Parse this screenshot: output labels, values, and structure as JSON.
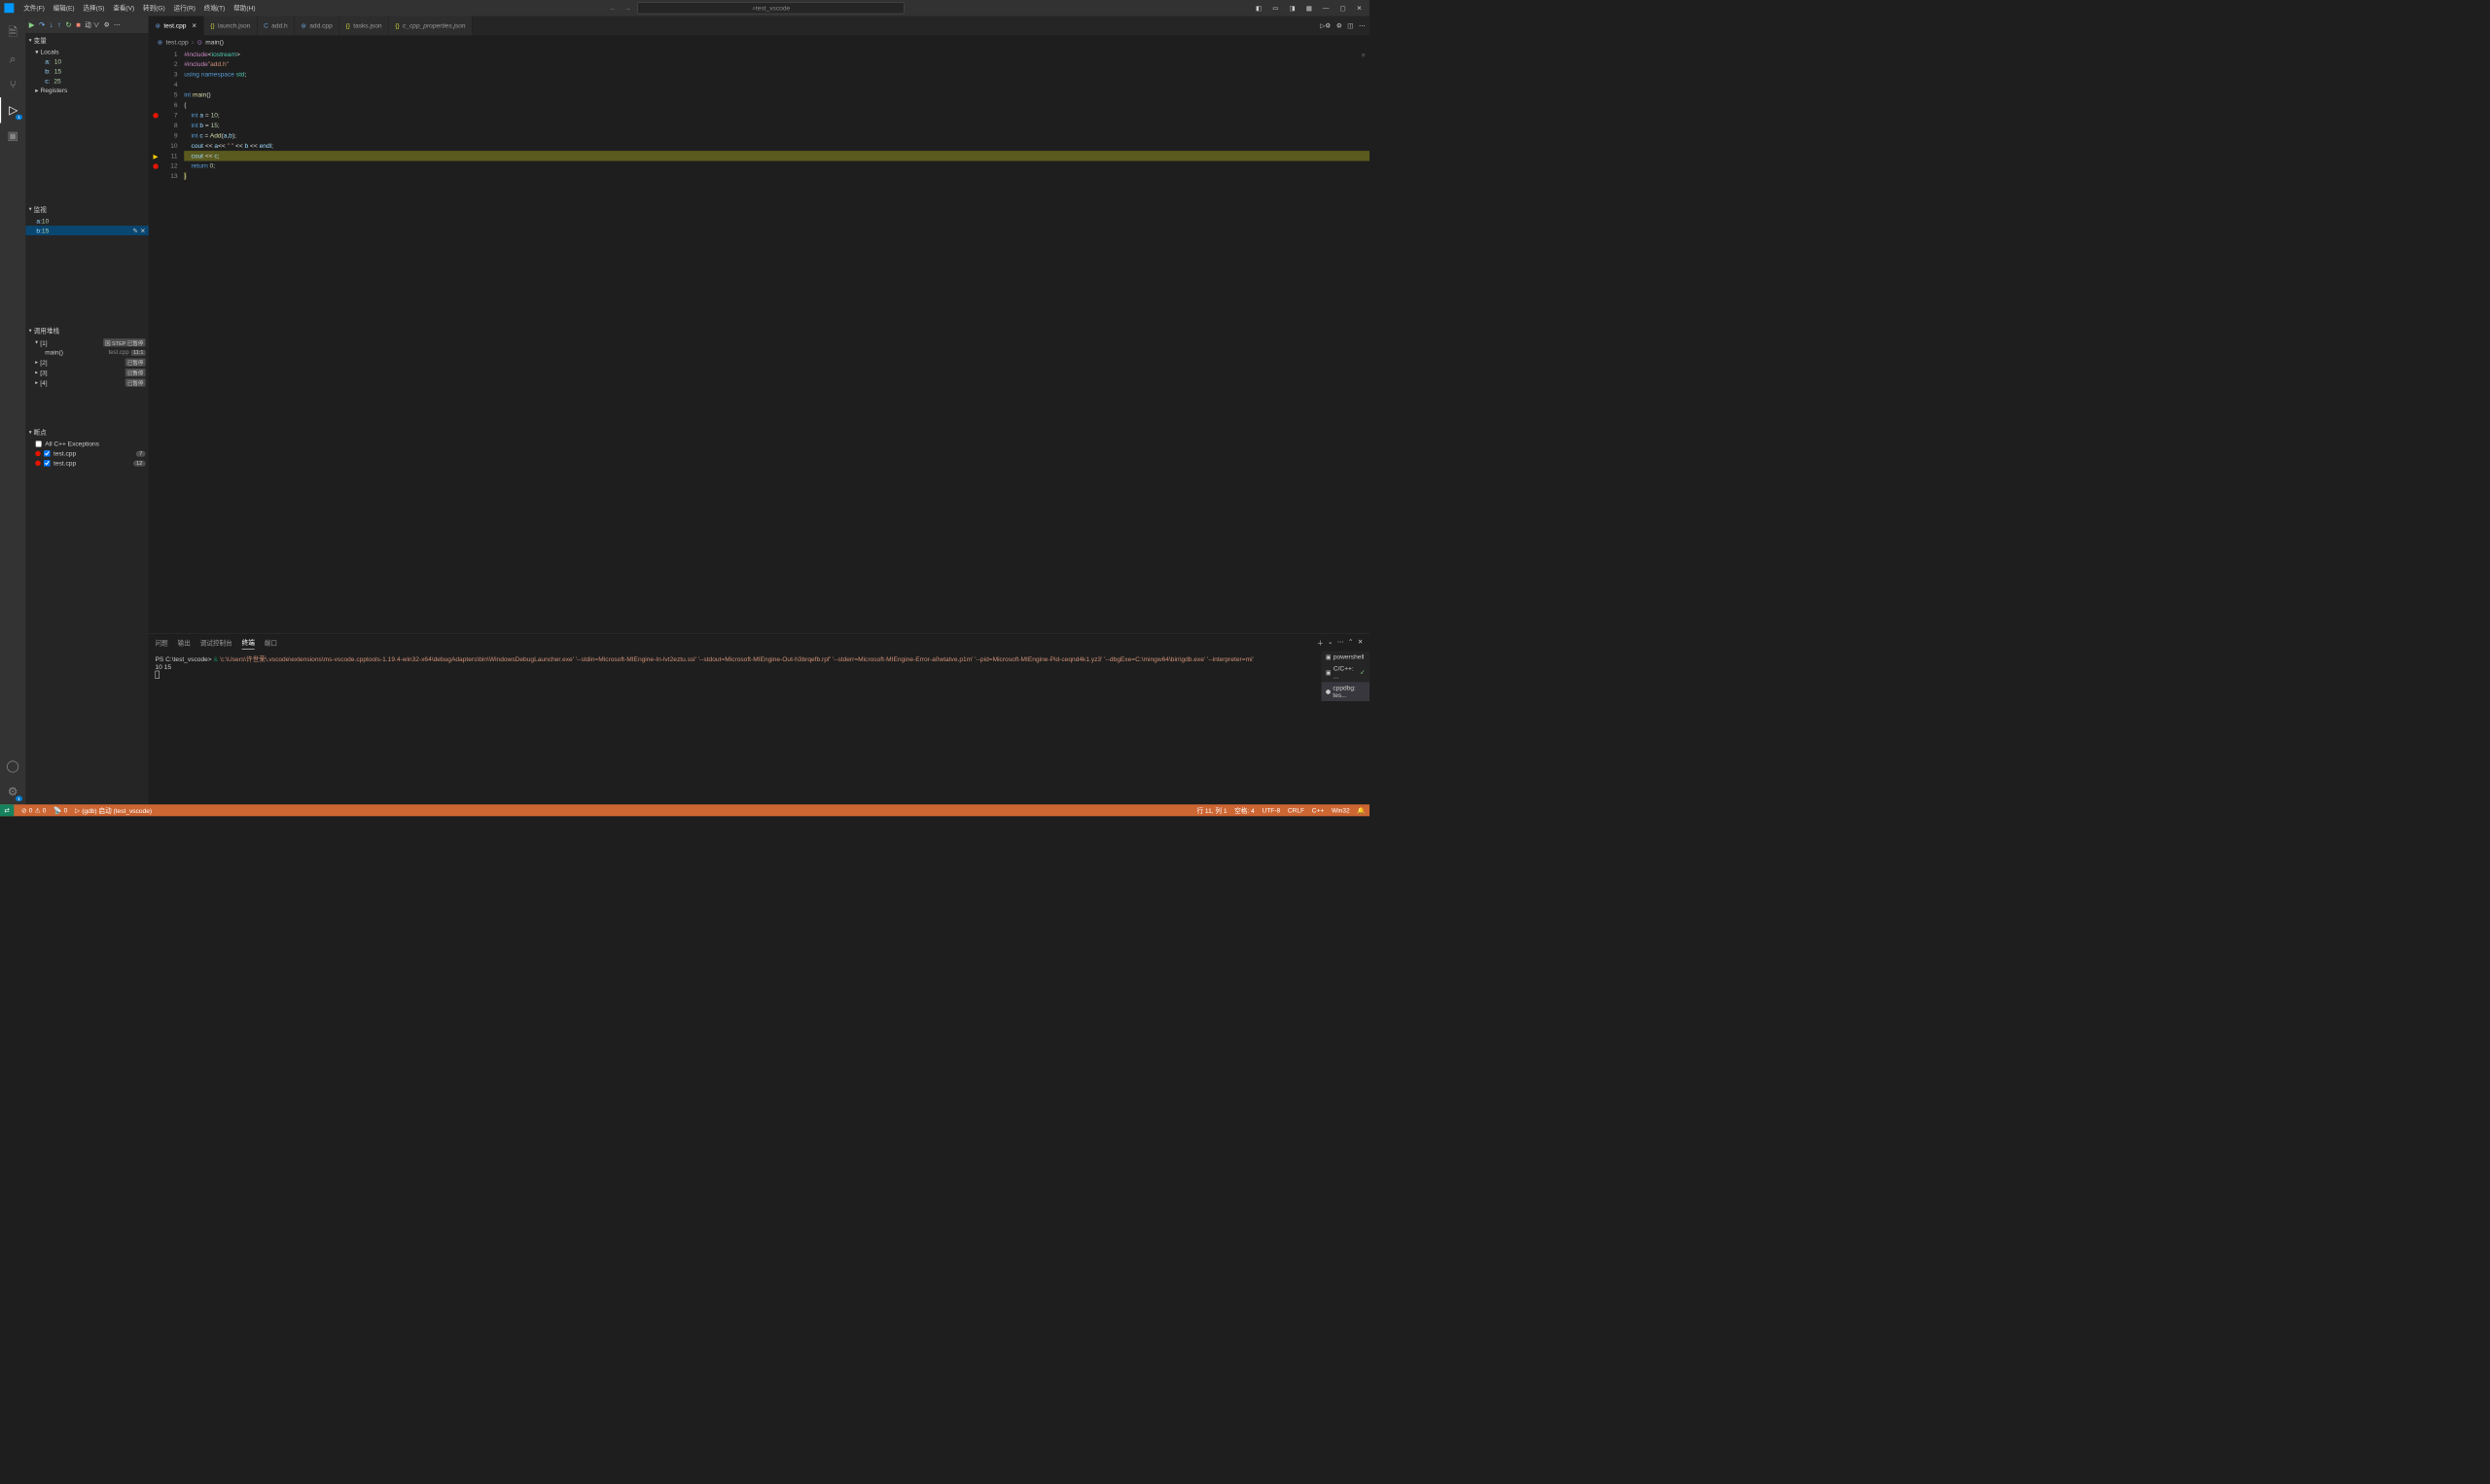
{
  "menu": [
    "文件(F)",
    "编辑(E)",
    "选择(S)",
    "查看(V)",
    "转到(G)",
    "运行(R)",
    "终端(T)",
    "帮助(H)"
  ],
  "search_placeholder": "test_vscode",
  "debug_config": "动 ∨",
  "sidebar": {
    "variables_title": "变量",
    "locals": "Locals",
    "vars": [
      {
        "name": "a:",
        "value": "10"
      },
      {
        "name": "b:",
        "value": "15"
      },
      {
        "name": "c:",
        "value": "25"
      }
    ],
    "registers": "Registers",
    "watch_title": "监视",
    "watch": [
      {
        "name": "a:",
        "value": "10"
      },
      {
        "name": "b:",
        "value": "15"
      }
    ],
    "callstack_title": "调用堆栈",
    "threads": [
      {
        "name": "[1]",
        "status": "因 STEP 已暂停",
        "frame": {
          "fn": "main()",
          "file": "test.cpp",
          "line": "11:1"
        }
      },
      {
        "name": "[2]",
        "status": "已暂停"
      },
      {
        "name": "[3]",
        "status": "已暂停"
      },
      {
        "name": "[4]",
        "status": "已暂停"
      }
    ],
    "breakpoints_title": "断点",
    "bp_exceptions": "All C++ Exceptions",
    "bp_items": [
      {
        "name": "test.cpp",
        "count": "7"
      },
      {
        "name": "test.cpp",
        "count": "12"
      }
    ]
  },
  "tabs": [
    {
      "name": "test.cpp",
      "icon": "cpp",
      "active": true,
      "close": true
    },
    {
      "name": "launch.json",
      "icon": "json"
    },
    {
      "name": "add.h",
      "icon": "cpp"
    },
    {
      "name": "add.cpp",
      "icon": "cpp"
    },
    {
      "name": "tasks.json",
      "icon": "json"
    },
    {
      "name": "c_cpp_properties.json",
      "icon": "json",
      "italic": true
    }
  ],
  "breadcrumb": {
    "file": "test.cpp",
    "symbol": "main()"
  },
  "code_lines": 13,
  "panel_tabs": [
    "问题",
    "输出",
    "调试控制台",
    "终端",
    "端口"
  ],
  "terminal": {
    "prompt": "PS C:\\test_vscode>",
    "cmd_prefix": " & ",
    "cmd": "'c:\\Users\\许世荣\\.vscode\\extensions\\ms-vscode.cpptools-1.19.4-win32-x64\\debugAdapters\\bin\\WindowsDebugLauncher.exe' '--stdin=Microsoft-MIEngine-In-lvt2eztu.ssl' '--stdout=Microsoft-MIEngine-Out-h3brqefb.rpf' '--stderr=Microsoft-MIEngine-Error-a0wtatve.p1m' '--pid=Microsoft-MIEngine-Pid-ceqnd4k1.yz3' '--dbgExe=C:\\mingw64\\bin\\gdb.exe' '--interpreter=mi'",
    "output": "10 15"
  },
  "term_list": [
    {
      "name": "powershell",
      "icon": "ps"
    },
    {
      "name": "C/C++: ...",
      "icon": "ps",
      "check": true
    },
    {
      "name": "cppdbg: tes...",
      "icon": "bug",
      "active": true
    }
  ],
  "status": {
    "errors": "0",
    "warnings": "0",
    "ports": "0",
    "debug": "(gdb) 启动 (test_vscode)",
    "line": "行 11, 列 1",
    "spaces": "空格: 4",
    "encoding": "UTF-8",
    "eol": "CRLF",
    "lang": "C++",
    "os": "Win32"
  }
}
